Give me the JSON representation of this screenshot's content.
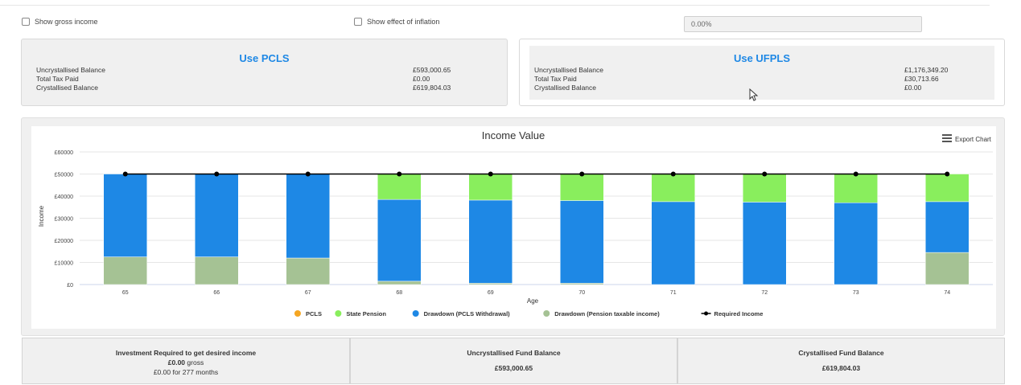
{
  "options": {
    "show_gross_income": "Show gross income",
    "show_inflation": "Show effect of inflation",
    "inflation_rate": "0.00%"
  },
  "pcls": {
    "title": "Use PCLS",
    "rows": [
      {
        "label": "Uncrystallised Balance",
        "value": "£593,000.65"
      },
      {
        "label": "Total Tax Paid",
        "value": "£0.00"
      },
      {
        "label": "Crystallised Balance",
        "value": "£619,804.03"
      }
    ]
  },
  "ufpls": {
    "title": "Use UFPLS",
    "rows": [
      {
        "label": "Uncrystallised Balance",
        "value": "£1,176,349.20"
      },
      {
        "label": "Total Tax Paid",
        "value": "£30,713.66"
      },
      {
        "label": "Crystallised Balance",
        "value": "£0.00"
      }
    ]
  },
  "export_label": "Export Chart",
  "chart_data": {
    "type": "bar",
    "stacked": true,
    "title": "Income Value",
    "xlabel": "Age",
    "ylabel": "Income",
    "ylim": [
      0,
      60000
    ],
    "yticks": [
      0,
      10000,
      20000,
      30000,
      40000,
      50000,
      60000
    ],
    "ytick_labels": [
      "£0",
      "£10000",
      "£20000",
      "£30000",
      "£40000",
      "£50000",
      "£60000"
    ],
    "categories": [
      "65",
      "66",
      "67",
      "68",
      "69",
      "70",
      "71",
      "72",
      "73",
      "74"
    ],
    "series": [
      {
        "name": "Drawdown (Pension taxable income)",
        "color": "#a5c294",
        "values": [
          12500,
          12500,
          12000,
          1500,
          600,
          600,
          0,
          0,
          0,
          14500
        ]
      },
      {
        "name": "Drawdown (PCLS Withdrawal)",
        "color": "#1e88e5",
        "values": [
          37500,
          37500,
          38000,
          37000,
          37600,
          37400,
          37500,
          37300,
          37000,
          23000
        ]
      },
      {
        "name": "State Pension",
        "color": "#89ee5d",
        "values": [
          0,
          0,
          0,
          11500,
          11800,
          12000,
          12500,
          12700,
          13000,
          12500
        ]
      },
      {
        "name": "PCLS",
        "color": "#f5a623",
        "values": [
          0,
          0,
          0,
          0,
          0,
          0,
          0,
          0,
          0,
          0
        ]
      }
    ],
    "line": {
      "name": "Required Income",
      "color": "#000000",
      "values": [
        50000,
        50000,
        50000,
        50000,
        50000,
        50000,
        50000,
        50000,
        50000,
        50000
      ]
    },
    "legend_order": [
      "PCLS",
      "State Pension",
      "Drawdown (PCLS Withdrawal)",
      "Drawdown (Pension taxable income)",
      "Required Income"
    ],
    "legend_position": "bottom",
    "grid": true
  },
  "summary": {
    "investment": {
      "title": "Investment Required to get desired income",
      "value": "£0.00",
      "value_suffix": "gross",
      "note": "£0.00 for 277 months"
    },
    "uncrystallised": {
      "title": "Uncrystallised Fund Balance",
      "value": "£593,000.65"
    },
    "crystallised": {
      "title": "Crystallised Fund Balance",
      "value": "£619,804.03"
    }
  }
}
